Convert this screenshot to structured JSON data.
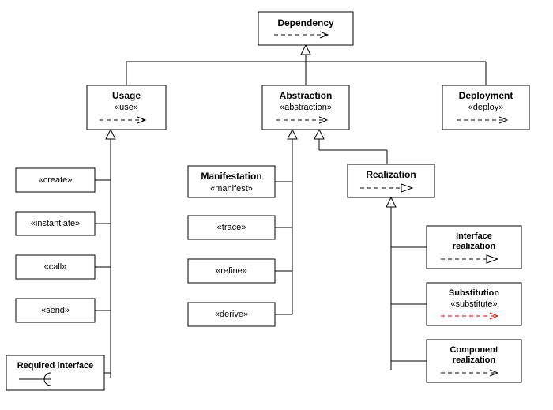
{
  "diagram": {
    "root": {
      "title": "Dependency"
    },
    "usage": {
      "title": "Usage",
      "stereotype": "«use»",
      "children": {
        "create": "«create»",
        "instantiate": "«instantiate»",
        "call": "«call»",
        "send": "«send»",
        "required_interface": "Required interface"
      }
    },
    "abstraction": {
      "title": "Abstraction",
      "stereotype": "«abstraction»",
      "manifestation": {
        "title": "Manifestation",
        "stereotype": "«manifest»"
      },
      "children": {
        "trace": "«trace»",
        "refine": "«refine»",
        "derive": "«derive»"
      },
      "realization": {
        "title": "Realization",
        "children": {
          "interface_realization_l1": "Interface",
          "interface_realization_l2": "realization",
          "substitution_title": "Substitution",
          "substitution_stereo": "«substitute»",
          "component_realization_l1": "Component",
          "component_realization_l2": "realization"
        }
      }
    },
    "deployment": {
      "title": "Deployment",
      "stereotype": "«deploy»"
    }
  }
}
